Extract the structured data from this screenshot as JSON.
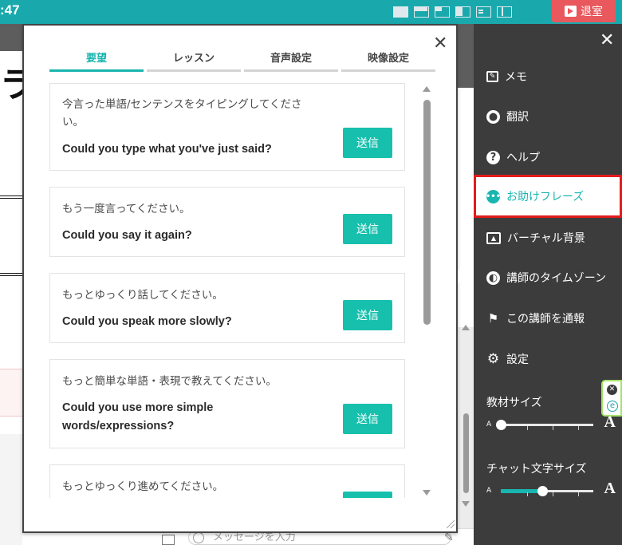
{
  "topbar": {
    "clock": ":47",
    "exit_label": "退室",
    "layout_icons": [
      "layout-full-icon",
      "layout-top-split-icon",
      "layout-quad-icon",
      "layout-split-icon",
      "layout-list-icon",
      "layout-sidebar-icon"
    ]
  },
  "background": {
    "heading_fragment": "ラ",
    "chat_placeholder": "メッセージを入力"
  },
  "popup": {
    "tabs": [
      {
        "label": "要望",
        "active": true
      },
      {
        "label": "レッスン",
        "active": false
      },
      {
        "label": "音声設定",
        "active": false
      },
      {
        "label": "映像設定",
        "active": false
      }
    ],
    "send_label": "送信",
    "phrases": [
      {
        "jp": "今言った単語/センテンスをタイピングしてください。",
        "en": "Could you type what you've just said?"
      },
      {
        "jp": "もう一度言ってください。",
        "en": "Could you say it again?"
      },
      {
        "jp": "もっとゆっくり話してください。",
        "en": "Could you speak more slowly?"
      },
      {
        "jp": "もっと簡単な単語・表現で教えてください。",
        "en": "Could you use more simple words/expressions?"
      },
      {
        "jp": "もっとゆっくり進めてください。",
        "en": ""
      }
    ]
  },
  "sidemenu": {
    "items": [
      {
        "label": "メモ",
        "icon": "edit-icon"
      },
      {
        "label": "翻訳",
        "icon": "globe-icon"
      },
      {
        "label": "ヘルプ",
        "icon": "question-icon"
      },
      {
        "label": "お助けフレーズ",
        "icon": "chat-bubble-icon",
        "active": true
      },
      {
        "label": "バーチャル背景",
        "icon": "image-icon"
      },
      {
        "label": "講師のタイムゾーン",
        "icon": "world-icon"
      },
      {
        "label": "この講師を通報",
        "icon": "flag-icon"
      },
      {
        "label": "設定",
        "icon": "gear-icon"
      }
    ],
    "material_size_label": "教材サイズ",
    "chat_font_size_label": "チャット文字サイズ",
    "slider_small": "A",
    "slider_large": "A",
    "material_size_level": 0.0,
    "chat_font_size_level": 0.45,
    "accent_color": "#19b5b0",
    "highlight_color": "#e31b1b"
  }
}
